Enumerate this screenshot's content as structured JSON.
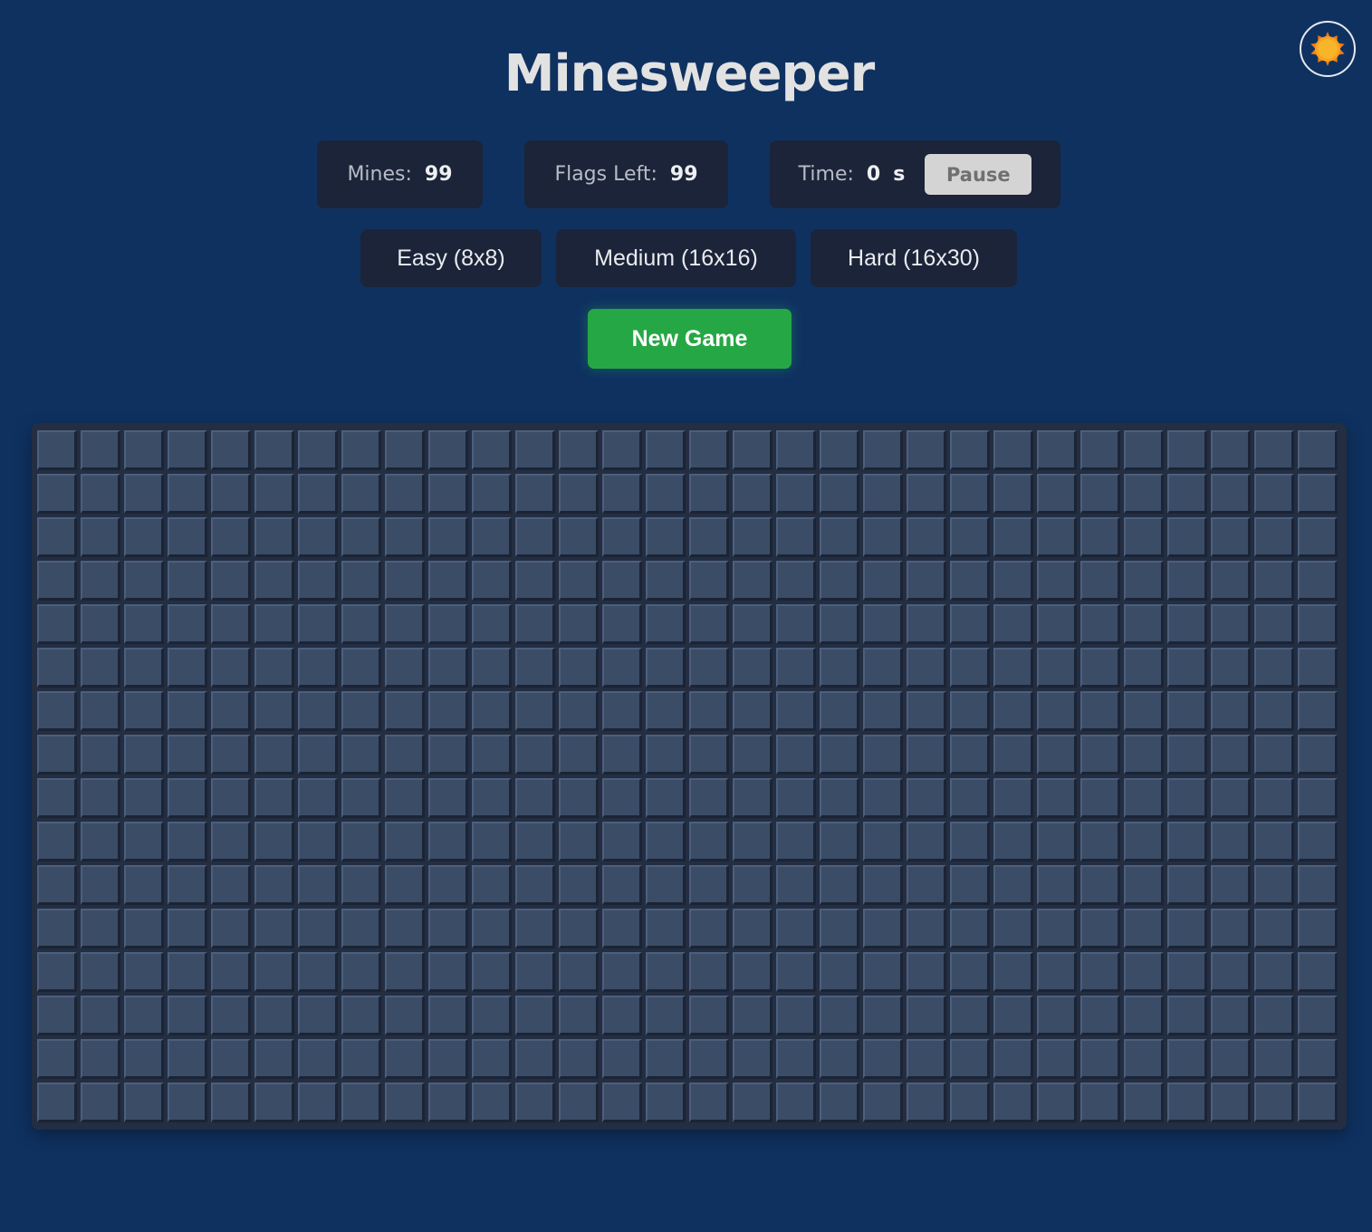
{
  "title": "Minesweeper",
  "theme_toggle": {
    "icon": "sun-icon"
  },
  "stats": {
    "mines_label": "Mines:",
    "mines_value": "99",
    "flags_label": "Flags Left:",
    "flags_value": "99",
    "time_label": "Time:",
    "time_value": "0",
    "time_unit": "s",
    "pause_label": "Pause"
  },
  "difficulties": {
    "easy": "Easy (8x8)",
    "medium": "Medium (16x16)",
    "hard": "Hard (16x30)"
  },
  "new_game_label": "New Game",
  "board": {
    "rows": 16,
    "cols": 30,
    "cell_state": "hidden"
  },
  "colors": {
    "background": "#0f3160",
    "panel": "#1b2438",
    "cell": "#3b4c67",
    "accent_green": "#26a745",
    "sun": "#f6a21e"
  }
}
